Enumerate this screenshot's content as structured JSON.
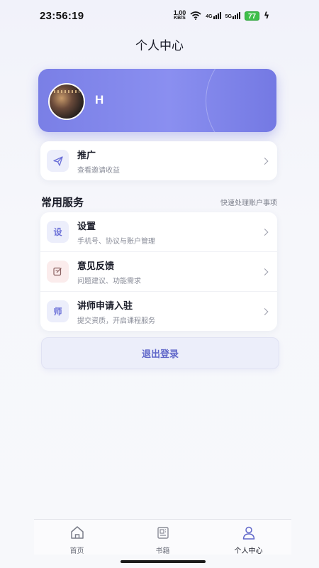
{
  "status_bar": {
    "time": "23:56:19",
    "net_speed_value": "1.00",
    "net_speed_unit": "KB/S",
    "sim1_label": "4G",
    "sim2_label": "5G",
    "battery": "77"
  },
  "header": {
    "title": "个人中心"
  },
  "profile": {
    "name": "H"
  },
  "promo": {
    "title": "推广",
    "subtitle": "查看邀请收益"
  },
  "services": {
    "title": "常用服务",
    "hint": "快速处理账户事项",
    "items": [
      {
        "icon_text": "设",
        "title": "设置",
        "subtitle": "手机号、协议与账户管理"
      },
      {
        "icon_text": "",
        "title": "意见反馈",
        "subtitle": "问题建议、功能需求"
      },
      {
        "icon_text": "师",
        "title": "讲师申请入驻",
        "subtitle": "提交资质，开启课程服务"
      }
    ]
  },
  "logout_label": "退出登录",
  "tabbar": {
    "items": [
      {
        "label": "首页",
        "icon": "home-icon"
      },
      {
        "label": "书籍",
        "icon": "book-icon"
      },
      {
        "label": "个人中心",
        "icon": "user-icon"
      }
    ],
    "active": "个人中心"
  },
  "colors": {
    "accent": "#7a7fe6",
    "logout_text": "#5f66c9",
    "battery": "#3fbf4a"
  }
}
